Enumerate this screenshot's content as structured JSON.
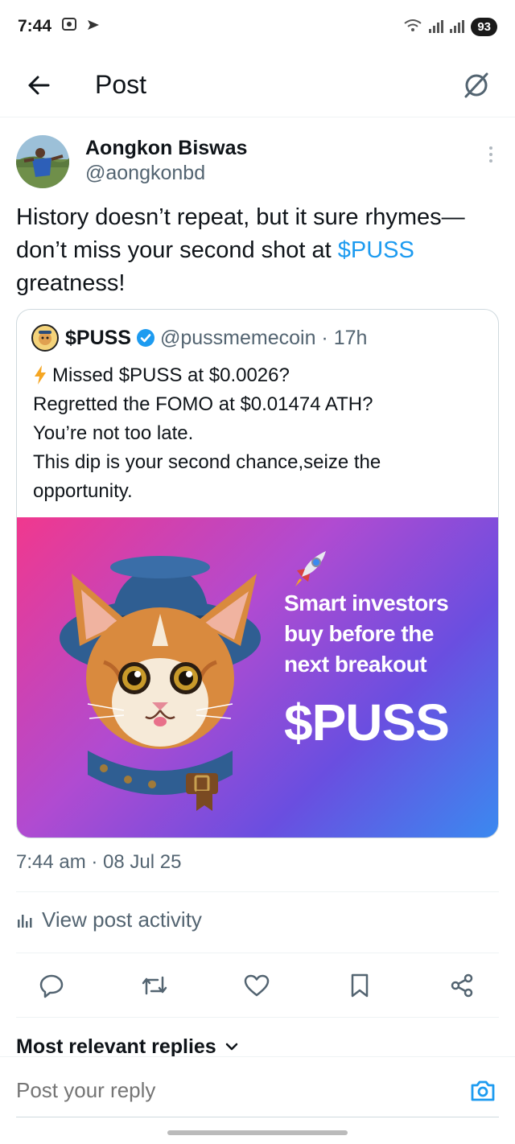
{
  "status_bar": {
    "time": "7:44",
    "battery": "93"
  },
  "header": {
    "title": "Post"
  },
  "post": {
    "author_name": "Aongkon Biswas",
    "author_handle": "@aongkonbd",
    "text_before": "History doesn’t repeat, but it sure rhymes—don’t miss your second shot at ",
    "cashtag": "$PUSS",
    "text_after": " greatness!",
    "timestamp": "7:44 am · 08 Jul 25"
  },
  "quote": {
    "name": "$PUSS",
    "handle_time": "@pussmemecoin · 17h",
    "lines": [
      "Missed $PUSS at $0.0026?",
      "Regretted the FOMO at $0.01474 ATH?",
      "You’re not too late.",
      "This dip is your second chance,seize the",
      "opportunity."
    ],
    "image": {
      "tagline_1": "Smart investors",
      "tagline_2": "buy before the",
      "tagline_3": "next breakout",
      "ticker": "$PUSS"
    }
  },
  "activity": {
    "label": "View post activity"
  },
  "replies": {
    "header": "Most relevant replies",
    "placeholder": "Post your reply"
  },
  "colors": {
    "accent": "#1d9bf0",
    "text_primary": "#0f1419",
    "text_secondary": "#536471"
  }
}
